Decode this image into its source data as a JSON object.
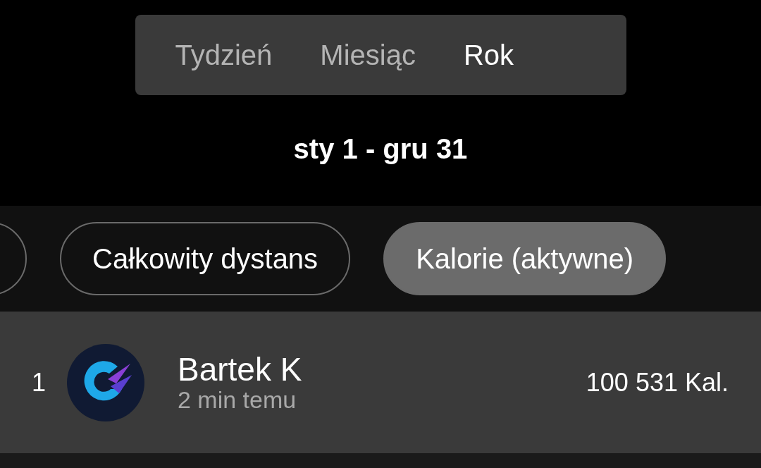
{
  "period_tabs": [
    {
      "label": "Tydzień",
      "selected": false
    },
    {
      "label": "Miesiąc",
      "selected": false
    },
    {
      "label": "Rok",
      "selected": true
    }
  ],
  "date_range": "sty 1 - gru 31",
  "filter_chips": [
    {
      "selected": false
    },
    {
      "label": "Całkowity dystans",
      "selected": false
    },
    {
      "label": "Kalorie (aktywne)",
      "selected": true
    }
  ],
  "leaderboard": [
    {
      "rank": "1",
      "name": "Bartek K",
      "time": "2 min temu",
      "value": "100 531 Kal."
    }
  ]
}
